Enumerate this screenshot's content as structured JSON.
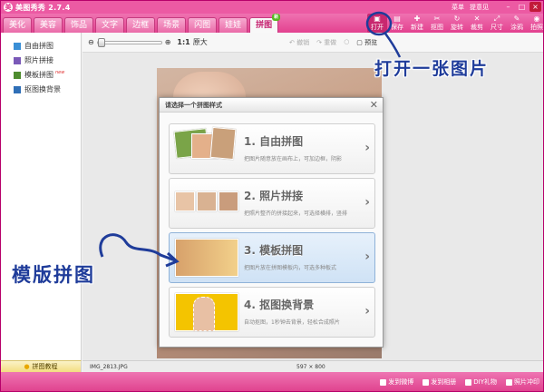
{
  "app": {
    "title": "美图秀秀 2.7.4",
    "icon_letter": "美",
    "links": [
      "菜单",
      "提意见"
    ]
  },
  "tabs": [
    {
      "label": "美化"
    },
    {
      "label": "美容"
    },
    {
      "label": "饰品"
    },
    {
      "label": "文字"
    },
    {
      "label": "边框"
    },
    {
      "label": "场景"
    },
    {
      "label": "闪图"
    },
    {
      "label": "娃娃"
    },
    {
      "label": "拼图",
      "active": true,
      "badge": "新"
    }
  ],
  "tools": [
    {
      "label": "打开",
      "icon": "folder-icon"
    },
    {
      "label": "保存",
      "icon": "save-icon"
    },
    {
      "label": "新建",
      "icon": "plus-icon"
    },
    {
      "label": "抠图",
      "icon": "scissors-icon"
    },
    {
      "label": "旋转",
      "icon": "rotate-icon"
    },
    {
      "label": "裁剪",
      "icon": "crop-icon"
    },
    {
      "label": "尺寸",
      "icon": "resize-icon"
    },
    {
      "label": "涂鸦",
      "icon": "pen-icon"
    },
    {
      "label": "拍照",
      "icon": "camera-icon"
    }
  ],
  "sidebar": {
    "items": [
      {
        "label": "自由拼图",
        "color": "#3a8fd6"
      },
      {
        "label": "照片拼接",
        "color": "#7a59b8"
      },
      {
        "label": "模板拼图",
        "color": "#4e8c2f",
        "new": "new"
      },
      {
        "label": "抠图换背景",
        "color": "#2f6fb7"
      }
    ],
    "bottom_label": "拼图教程"
  },
  "subbar": {
    "zoom_ratio": "1:1",
    "original": "原大",
    "undo": "撤销",
    "redo": "重做",
    "preview": "预览"
  },
  "status": {
    "filename": "IMG_2813.JPG",
    "dimensions": "597 × 800"
  },
  "bottombar": {
    "items": [
      "发到微博",
      "发到相册",
      "DIY礼物",
      "照片冲印"
    ]
  },
  "dialog": {
    "title": "请选择一个拼图样式",
    "options": [
      {
        "title": "1. 自由拼图",
        "desc": "把图片随意放在画布上，可加边框，阴影"
      },
      {
        "title": "2. 照片拼接",
        "desc": "把照片整齐的拼接起来，可选择横排，竖排"
      },
      {
        "title": "3. 模板拼图",
        "desc": "把图片放在拼图模板内，可选多种板式"
      },
      {
        "title": "4. 抠图换背景",
        "desc": "自动抠图，1秒钟去背景，轻松合成照片"
      }
    ]
  },
  "annotations": {
    "open": "打开一张图片",
    "template": "模版拼图"
  },
  "colors": {
    "brand_pink": "#e4388b",
    "annotation_blue": "#1f3c9a"
  }
}
